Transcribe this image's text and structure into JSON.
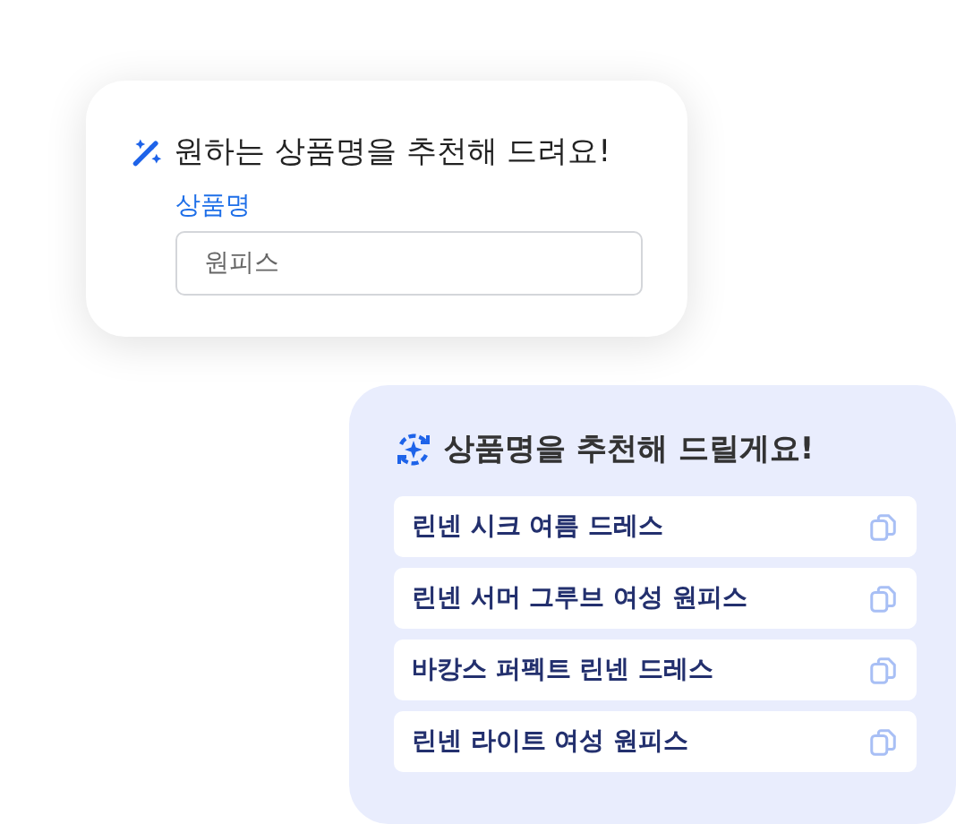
{
  "request_card": {
    "title": "원하는 상품명을 추천해 드려요!",
    "field": {
      "label": "상품명",
      "value": "원피스"
    }
  },
  "suggestions_card": {
    "title": "상품명을 추천해 드릴게요!",
    "items": [
      {
        "text": "린넨 시크 여름 드레스"
      },
      {
        "text": "린넨 서머 그루브 여성 원피스"
      },
      {
        "text": "바캉스 퍼펙트 린넨 드레스"
      },
      {
        "text": "린넨 라이트 여성 원피스"
      }
    ]
  }
}
